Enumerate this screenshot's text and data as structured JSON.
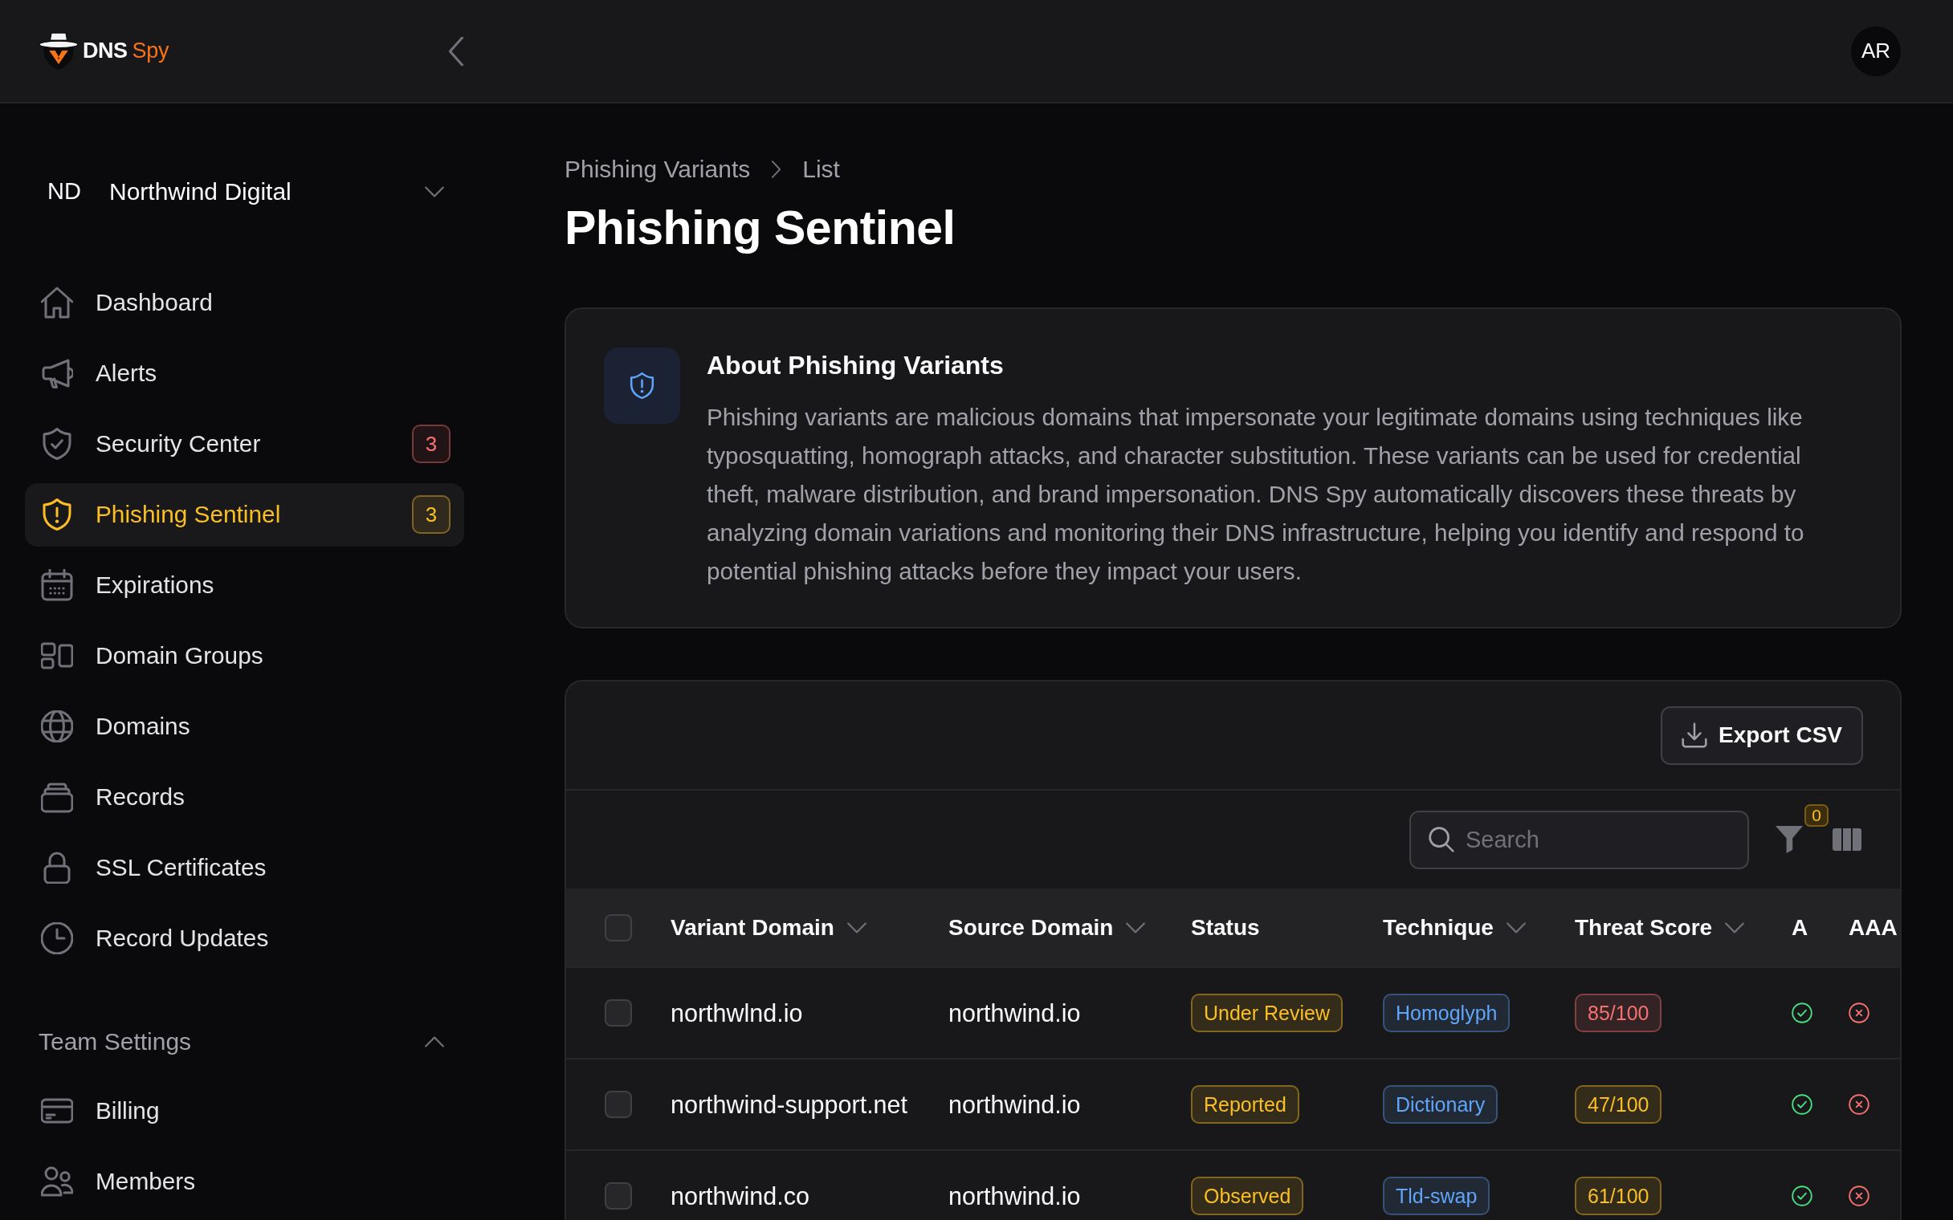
{
  "header": {
    "brand": {
      "name": "DNS",
      "accent": "Spy"
    },
    "avatar": "AR"
  },
  "sidebar": {
    "organization": {
      "initials": "ND",
      "name": "Northwind Digital"
    },
    "items": [
      {
        "label": "Dashboard",
        "selected": false
      },
      {
        "label": "Alerts",
        "selected": false
      },
      {
        "label": "Security Center",
        "selected": false,
        "badge": {
          "text": "3",
          "color": "#f87171"
        }
      },
      {
        "label": "Phishing Sentinel",
        "selected": true,
        "badge": {
          "text": "3",
          "color": "#fbbf24"
        }
      },
      {
        "label": "Expirations",
        "selected": false
      },
      {
        "label": "Domain Groups",
        "selected": false
      },
      {
        "label": "Domains",
        "selected": false
      },
      {
        "label": "Records",
        "selected": false
      },
      {
        "label": "SSL Certificates",
        "selected": false
      },
      {
        "label": "Record Updates",
        "selected": false
      }
    ],
    "sections": [
      {
        "title": "Team Settings",
        "expanded": true,
        "items": [
          {
            "label": "Billing",
            "selected": false
          },
          {
            "label": "Members",
            "selected": false
          }
        ]
      }
    ]
  },
  "breadcrumb": [
    {
      "label": "Phishing Variants"
    },
    {
      "label": "List"
    }
  ],
  "page_title": "Phishing Sentinel",
  "info_card": {
    "title": "About Phishing Variants",
    "body": "Phishing variants are malicious domains that impersonate your legitimate domains using techniques like typosquatting, homograph attacks, and character substitution. These variants can be used for credential theft, malware distribution, and brand impersonation. DNS Spy automatically discovers these threats by analyzing domain variations and monitoring their DNS infrastructure, helping you identify and respond to potential phishing attacks before they impact your users."
  },
  "table": {
    "toolbar": {
      "export_button": "Export CSV",
      "search": {
        "placeholder": "Search"
      },
      "filter_count": "0"
    },
    "select_all": {
      "checked": false
    },
    "columns": [
      {
        "label": "Variant Domain",
        "sortable": true
      },
      {
        "label": "Source Domain",
        "sortable": true
      },
      {
        "label": "Status",
        "sortable": false
      },
      {
        "label": "Technique",
        "sortable": true
      },
      {
        "label": "Threat Score",
        "sortable": true
      },
      {
        "label": "A",
        "sortable": false
      },
      {
        "label": "AAA",
        "sortable": false
      }
    ],
    "rows": [
      {
        "checked": false,
        "variant_domain": "northwlnd.io",
        "source_domain": "northwind.io",
        "status": "Under Review",
        "technique": "Homoglyph",
        "threat_score": {
          "text": "85/100",
          "color": "#f87171"
        },
        "a": true,
        "column_7": false
      },
      {
        "checked": false,
        "variant_domain": "northwind-support.net",
        "source_domain": "northwind.io",
        "status": "Reported",
        "technique": "Dictionary",
        "threat_score": {
          "text": "47/100",
          "color": "#fbbf24"
        },
        "a": true,
        "column_7": false
      },
      {
        "checked": false,
        "variant_domain": "northwind.co",
        "source_domain": "northwind.io",
        "status": "Observed",
        "technique": "Tld-swap",
        "threat_score": {
          "text": "61/100",
          "color": "#fbbf24"
        },
        "a": true,
        "column_7": false
      }
    ]
  }
}
